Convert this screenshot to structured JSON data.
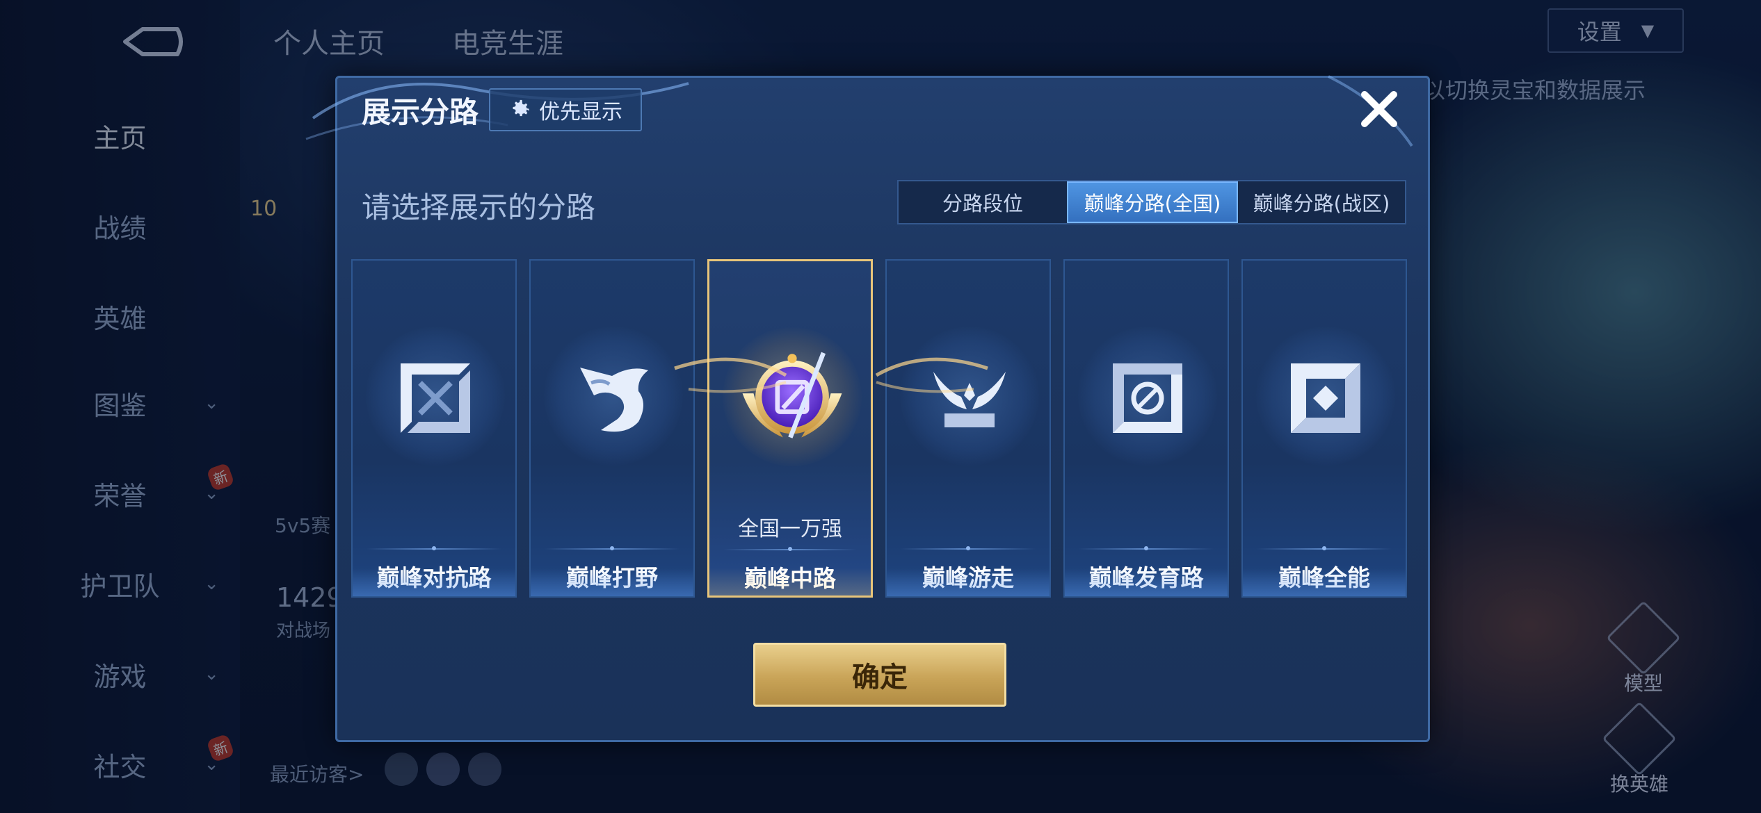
{
  "background": {
    "top_tabs": [
      "个人主页",
      "电竞生涯"
    ],
    "settings_label": "设置",
    "hint": "以切换灵宝和数据展示",
    "sidebar": [
      {
        "label": "主页",
        "active": true,
        "chevron": false
      },
      {
        "label": "战绩",
        "chevron": false
      },
      {
        "label": "英雄",
        "chevron": false
      },
      {
        "label": "图鉴",
        "chevron": true
      },
      {
        "label": "荣誉",
        "chevron": true,
        "badge": "新"
      },
      {
        "label": "护卫队",
        "chevron": true
      },
      {
        "label": "游戏",
        "chevron": true
      },
      {
        "label": "社交",
        "chevron": true,
        "badge": "新"
      }
    ],
    "profile": {
      "level": "10",
      "mode": "5v5赛",
      "score": "1429",
      "score_caption": "对战场",
      "recent_visitors": "最近访客>"
    },
    "right_buttons": [
      "模型",
      "换英雄"
    ]
  },
  "dialog": {
    "title": "展示分路",
    "priority_label": "优先显示",
    "subtitle": "请选择展示的分路",
    "tabs": [
      {
        "label": "分路段位",
        "active": false
      },
      {
        "label": "巅峰分路(全国)",
        "active": true
      },
      {
        "label": "巅峰分路(战区)",
        "active": false
      }
    ],
    "cards": [
      {
        "label": "巅峰对抗路",
        "icon": "clash-lane-icon",
        "rank": ""
      },
      {
        "label": "巅峰打野",
        "icon": "jungle-icon",
        "rank": ""
      },
      {
        "label": "巅峰中路",
        "icon": "mid-lane-icon",
        "rank": "全国一万强",
        "selected": true
      },
      {
        "label": "巅峰游走",
        "icon": "roam-icon",
        "rank": ""
      },
      {
        "label": "巅峰发育路",
        "icon": "farm-lane-icon",
        "rank": ""
      },
      {
        "label": "巅峰全能",
        "icon": "all-round-icon",
        "rank": ""
      }
    ],
    "confirm_label": "确定"
  },
  "colors": {
    "accent_gold": "#e8c57a",
    "active_tab": "#4f95e2",
    "dialog_bg": "#1d365f"
  }
}
